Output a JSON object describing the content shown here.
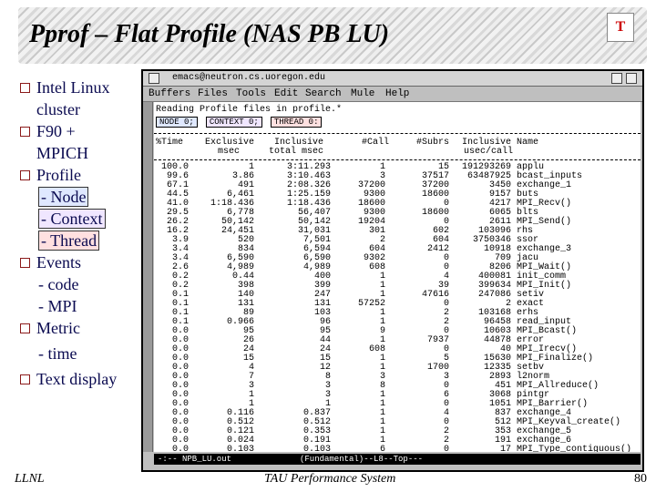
{
  "slide": {
    "title": "Pprof – Flat Profile (NAS PB LU)",
    "logo_text": "T",
    "bullets": [
      {
        "label": "Intel Linux cluster"
      },
      {
        "label": "F90 + MPICH"
      },
      {
        "label": "Profile"
      },
      {
        "label": "Events"
      },
      {
        "label": "Metric"
      },
      {
        "label": "Text display"
      }
    ],
    "profile_subs": [
      "- Node",
      "- Context",
      "- Thread"
    ],
    "events_subs": [
      "- code",
      "- MPI"
    ],
    "metric_subs": [
      "- time"
    ],
    "footer_left": "LLNL",
    "footer_center": "TAU Performance System",
    "page_number": "80"
  },
  "window": {
    "title": "emacs@neutron.cs.uoregon.edu",
    "menu": [
      "Buffers",
      "Files",
      "Tools",
      "Edit",
      "Search",
      "Mule",
      "Help"
    ],
    "reading_line": "Reading Profile files in profile.*",
    "node_btn": "NODE 0;",
    "context_btn": "CONTEXT 0;",
    "thread_btn": "THREAD 0:",
    "headers": {
      "time": "%Time",
      "exclusive": "Exclusive",
      "exclusive_unit": "msec",
      "inclusive": "Inclusive",
      "inclusive_unit": "total msec",
      "call": "#Call",
      "subrs": "#Subrs",
      "incl_usec": "Inclusive",
      "incl_usec_unit": "usec/call",
      "name": "Name"
    },
    "rows": [
      {
        "time": "100.0",
        "excl": "1",
        "incl": "3:11.293",
        "call": "1",
        "subrs": "15",
        "usec": "191293269",
        "name": "applu"
      },
      {
        "time": "99.6",
        "excl": "3.86",
        "incl": "3:10.463",
        "call": "3",
        "subrs": "37517",
        "usec": "63487925",
        "name": "bcast_inputs"
      },
      {
        "time": "67.1",
        "excl": "491",
        "incl": "2:08.326",
        "call": "37200",
        "subrs": "37200",
        "usec": "3450",
        "name": "exchange_1"
      },
      {
        "time": "44.5",
        "excl": "6,461",
        "incl": "1:25.159",
        "call": "9300",
        "subrs": "18600",
        "usec": "9157",
        "name": "buts"
      },
      {
        "time": "41.0",
        "excl": "1:18.436",
        "incl": "1:18.436",
        "call": "18600",
        "subrs": "0",
        "usec": "4217",
        "name": "MPI_Recv()"
      },
      {
        "time": "29.5",
        "excl": "6,778",
        "incl": "56,407",
        "call": "9300",
        "subrs": "18600",
        "usec": "6065",
        "name": "blts"
      },
      {
        "time": "26.2",
        "excl": "50,142",
        "incl": "50,142",
        "call": "19204",
        "subrs": "0",
        "usec": "2611",
        "name": "MPI_Send()"
      },
      {
        "time": "16.2",
        "excl": "24,451",
        "incl": "31,031",
        "call": "301",
        "subrs": "602",
        "usec": "103096",
        "name": "rhs"
      },
      {
        "time": "3.9",
        "excl": "520",
        "incl": "7,501",
        "call": "2",
        "subrs": "604",
        "usec": "3750346",
        "name": "ssor"
      },
      {
        "time": "3.4",
        "excl": "834",
        "incl": "6,594",
        "call": "604",
        "subrs": "2412",
        "usec": "10918",
        "name": "exchange_3"
      },
      {
        "time": "3.4",
        "excl": "6,590",
        "incl": "6,590",
        "call": "9302",
        "subrs": "0",
        "usec": "709",
        "name": "jacu"
      },
      {
        "time": "2.6",
        "excl": "4,989",
        "incl": "4,989",
        "call": "608",
        "subrs": "0",
        "usec": "8206",
        "name": "MPI_Wait()"
      },
      {
        "time": "0.2",
        "excl": "0.44",
        "incl": "400",
        "call": "1",
        "subrs": "4",
        "usec": "400081",
        "name": "init_comm"
      },
      {
        "time": "0.2",
        "excl": "398",
        "incl": "399",
        "call": "1",
        "subrs": "39",
        "usec": "399634",
        "name": "MPI_Init()"
      },
      {
        "time": "0.1",
        "excl": "140",
        "incl": "247",
        "call": "1",
        "subrs": "47616",
        "usec": "247086",
        "name": "setiv"
      },
      {
        "time": "0.1",
        "excl": "131",
        "incl": "131",
        "call": "57252",
        "subrs": "0",
        "usec": "2",
        "name": "exact"
      },
      {
        "time": "0.1",
        "excl": "89",
        "incl": "103",
        "call": "1",
        "subrs": "2",
        "usec": "103168",
        "name": "erhs"
      },
      {
        "time": "0.1",
        "excl": "0.966",
        "incl": "96",
        "call": "1",
        "subrs": "2",
        "usec": "96458",
        "name": "read_input"
      },
      {
        "time": "0.0",
        "excl": "95",
        "incl": "95",
        "call": "9",
        "subrs": "0",
        "usec": "10603",
        "name": "MPI_Bcast()"
      },
      {
        "time": "0.0",
        "excl": "26",
        "incl": "44",
        "call": "1",
        "subrs": "7937",
        "usec": "44878",
        "name": "error"
      },
      {
        "time": "0.0",
        "excl": "24",
        "incl": "24",
        "call": "608",
        "subrs": "0",
        "usec": "40",
        "name": "MPI_Irecv()"
      },
      {
        "time": "0.0",
        "excl": "15",
        "incl": "15",
        "call": "1",
        "subrs": "5",
        "usec": "15630",
        "name": "MPI_Finalize()"
      },
      {
        "time": "0.0",
        "excl": "4",
        "incl": "12",
        "call": "1",
        "subrs": "1700",
        "usec": "12335",
        "name": "setbv"
      },
      {
        "time": "0.0",
        "excl": "7",
        "incl": "8",
        "call": "3",
        "subrs": "3",
        "usec": "2893",
        "name": "l2norm"
      },
      {
        "time": "0.0",
        "excl": "3",
        "incl": "3",
        "call": "8",
        "subrs": "0",
        "usec": "451",
        "name": "MPI_Allreduce()"
      },
      {
        "time": "0.0",
        "excl": "1",
        "incl": "3",
        "call": "1",
        "subrs": "6",
        "usec": "3068",
        "name": "pintgr"
      },
      {
        "time": "0.0",
        "excl": "1",
        "incl": "1",
        "call": "1",
        "subrs": "0",
        "usec": "1051",
        "name": "MPI_Barrier()"
      },
      {
        "time": "0.0",
        "excl": "0.116",
        "incl": "0.837",
        "call": "1",
        "subrs": "4",
        "usec": "837",
        "name": "exchange_4"
      },
      {
        "time": "0.0",
        "excl": "0.512",
        "incl": "0.512",
        "call": "1",
        "subrs": "0",
        "usec": "512",
        "name": "MPI_Keyval_create()"
      },
      {
        "time": "0.0",
        "excl": "0.121",
        "incl": "0.353",
        "call": "1",
        "subrs": "2",
        "usec": "353",
        "name": "exchange_5"
      },
      {
        "time": "0.0",
        "excl": "0.024",
        "incl": "0.191",
        "call": "1",
        "subrs": "2",
        "usec": "191",
        "name": "exchange_6"
      },
      {
        "time": "0.0",
        "excl": "0.103",
        "incl": "0.103",
        "call": "6",
        "subrs": "0",
        "usec": "17",
        "name": "MPI_Type_contiguous()"
      }
    ],
    "status_left": "-:--  NPB_LU.out",
    "status_mode": "(Fundamental)--L8--Top---"
  }
}
